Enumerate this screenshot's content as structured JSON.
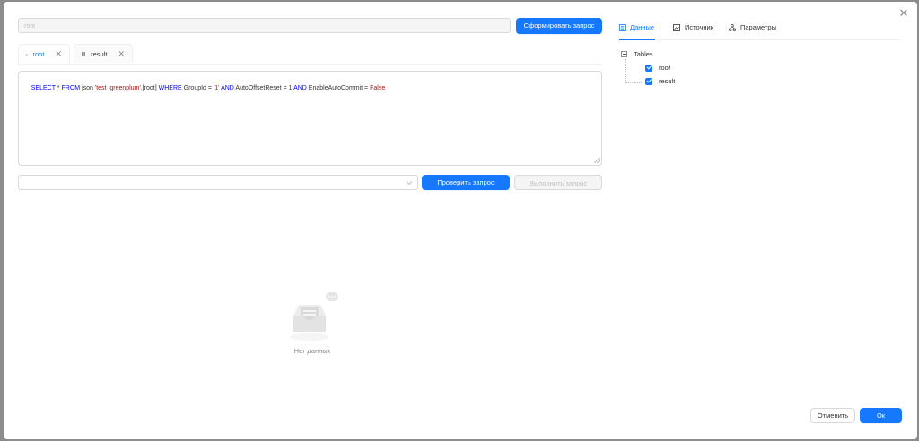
{
  "header": {
    "root_input_placeholder": "root",
    "form_query_button": "Сформировать запрос"
  },
  "tabs": [
    {
      "label": "root",
      "icon": "table-icon",
      "active": true
    },
    {
      "label": "result",
      "icon": "table-icon",
      "active": false
    }
  ],
  "editor": {
    "sql_tokens": [
      {
        "text": "SELECT",
        "type": "keyword"
      },
      {
        "text": " * ",
        "type": "plain"
      },
      {
        "text": "FROM",
        "type": "keyword"
      },
      {
        "text": " json ",
        "type": "plain"
      },
      {
        "text": "'test_greenplum'",
        "type": "string"
      },
      {
        "text": ".[root] ",
        "type": "plain"
      },
      {
        "text": "WHERE",
        "type": "keyword"
      },
      {
        "text": " GroupId = ",
        "type": "plain"
      },
      {
        "text": "'1'",
        "type": "string"
      },
      {
        "text": " ",
        "type": "plain"
      },
      {
        "text": "AND",
        "type": "keyword"
      },
      {
        "text": " AutoOffsetReset = 1 ",
        "type": "plain"
      },
      {
        "text": "AND",
        "type": "keyword"
      },
      {
        "text": " EnableAutoCommit = ",
        "type": "plain"
      },
      {
        "text": "False",
        "type": "string"
      }
    ]
  },
  "actions": {
    "select_value": "",
    "check_query_button": "Проверить запрос",
    "run_query_button": "Выполнить запрос"
  },
  "empty_state": {
    "text": "Нет данных"
  },
  "right_panel": {
    "tabs": [
      {
        "label": "Данные",
        "icon": "document-icon",
        "active": true
      },
      {
        "label": "Источник",
        "icon": "image-icon",
        "active": false
      },
      {
        "label": "Параметры",
        "icon": "nodes-icon",
        "active": false
      }
    ],
    "tree": {
      "root_label": "Tables",
      "children": [
        {
          "label": "root",
          "checked": true
        },
        {
          "label": "result",
          "checked": true
        }
      ]
    }
  },
  "footer": {
    "cancel_button": "Отменить",
    "ok_button": "Ок"
  },
  "colors": {
    "primary": "#1677ff",
    "sql_keyword": "#0000ff",
    "sql_string": "#a31515"
  }
}
